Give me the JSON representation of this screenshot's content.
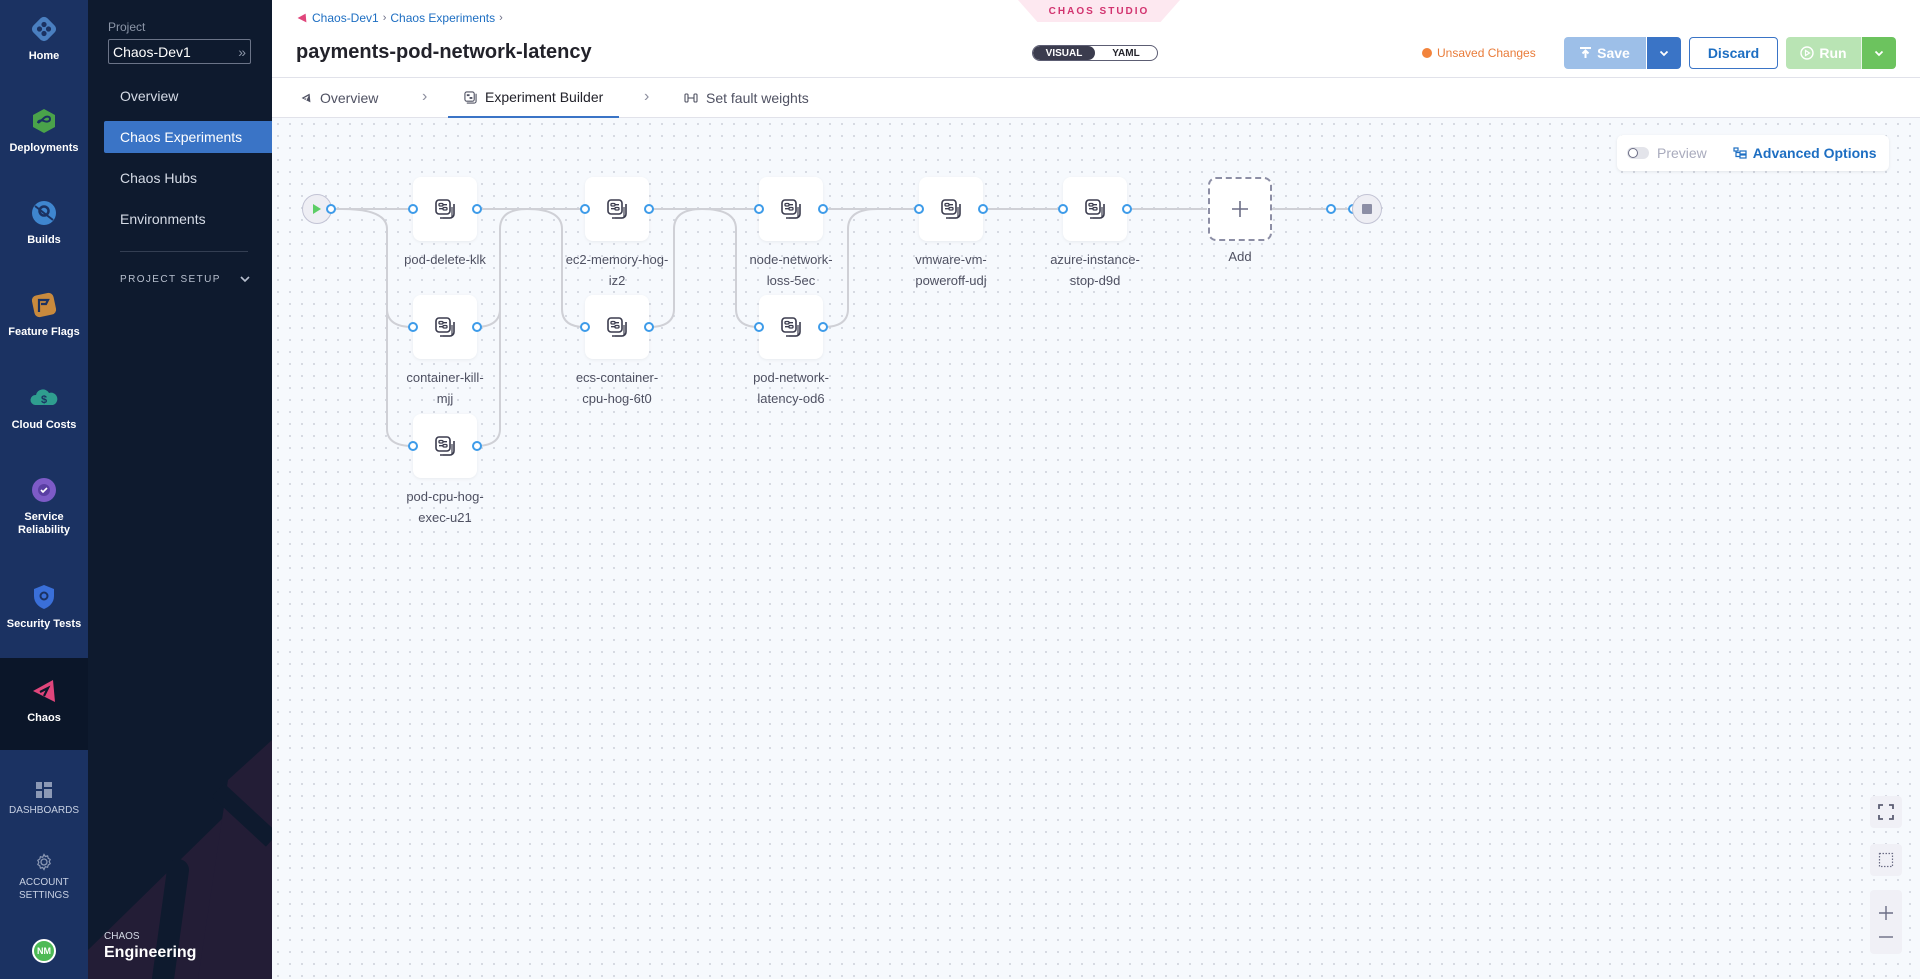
{
  "rail": {
    "items": [
      {
        "label": "Home",
        "icon": "home-icon"
      },
      {
        "label": "Deployments",
        "icon": "deployments-icon"
      },
      {
        "label": "Builds",
        "icon": "builds-icon"
      },
      {
        "label": "Feature Flags",
        "icon": "feature-flags-icon"
      },
      {
        "label": "Cloud Costs",
        "icon": "cloud-costs-icon"
      },
      {
        "label": "Service Reliability",
        "icon": "service-reliability-icon"
      },
      {
        "label": "Security Tests",
        "icon": "security-tests-icon"
      },
      {
        "label": "Chaos",
        "icon": "chaos-icon",
        "active": true
      }
    ],
    "dashboards": "DASHBOARDS",
    "account_settings": "ACCOUNT SETTINGS",
    "avatar_initials": "NM"
  },
  "nav": {
    "project_label": "Project",
    "project_value": "Chaos-Dev1",
    "items": [
      {
        "label": "Overview"
      },
      {
        "label": "Chaos Experiments",
        "active": true
      },
      {
        "label": "Chaos Hubs"
      },
      {
        "label": "Environments"
      }
    ],
    "project_setup": "PROJECT SETUP",
    "brand_sub": "CHAOS",
    "brand_main": "Engineering"
  },
  "header": {
    "breadcrumbs": [
      "Chaos-Dev1",
      "Chaos Experiments"
    ],
    "title": "payments-pod-network-latency",
    "studio_label": "CHAOS STUDIO",
    "view_toggle": {
      "visual": "VISUAL",
      "yaml": "YAML",
      "selected": "VISUAL"
    },
    "unsaved": "Unsaved Changes",
    "save": "Save",
    "discard": "Discard",
    "run": "Run",
    "colors": {
      "primary": "#3a74c6",
      "run": "#6cc35e",
      "unsaved": "#f2833b",
      "chaos": "#d2336f"
    }
  },
  "tabs": [
    {
      "label": "Overview",
      "icon": "overview-icon"
    },
    {
      "label": "Experiment Builder",
      "icon": "experiment-builder-icon",
      "active": true
    },
    {
      "label": "Set fault weights",
      "icon": "weights-icon"
    }
  ],
  "canvas": {
    "preview_label": "Preview",
    "preview_enabled": false,
    "advanced_options": "Advanced Options",
    "add_label": "Add",
    "faults": [
      {
        "label": "pod-delete-klk",
        "stage": 1
      },
      {
        "label": "container-kill-mjj",
        "stage": 1
      },
      {
        "label": "pod-cpu-hog-exec-u21",
        "stage": 1
      },
      {
        "label": "ec2-memory-hog-iz2",
        "stage": 2
      },
      {
        "label": "ecs-container-cpu-hog-6t0",
        "stage": 2
      },
      {
        "label": "node-network-loss-5ec",
        "stage": 3
      },
      {
        "label": "pod-network-latency-od6",
        "stage": 3
      },
      {
        "label": "vmware-vm-poweroff-udj",
        "stage": 4
      },
      {
        "label": "azure-instance-stop-d9d",
        "stage": 5
      }
    ]
  }
}
